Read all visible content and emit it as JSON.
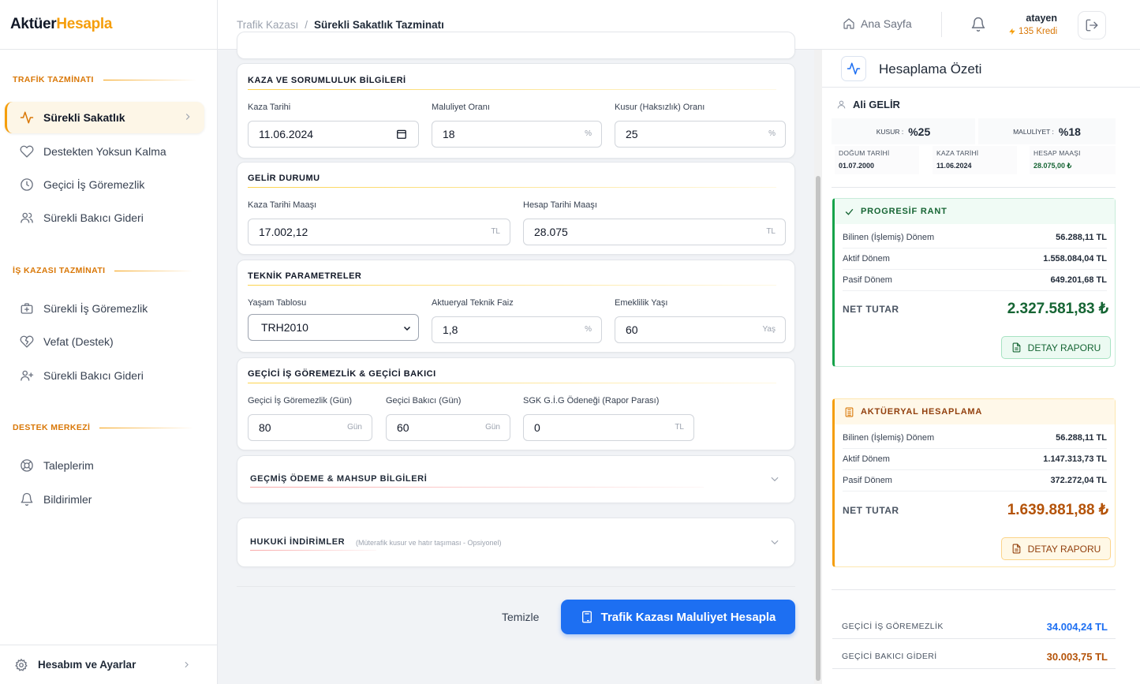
{
  "brand": {
    "part1": "Aktüer",
    "part2": "Hesapla",
    "accent": "#f59e0b"
  },
  "sidebar": {
    "sections": [
      {
        "title": "TRAFİK TAZMİNATI",
        "items": [
          {
            "label": "Sürekli Sakatlık",
            "icon": "activity-icon",
            "active": true
          },
          {
            "label": "Destekten Yoksun Kalma",
            "icon": "heart-icon"
          },
          {
            "label": "Geçici İş Göremezlik",
            "icon": "clock-icon"
          },
          {
            "label": "Sürekli Bakıcı Gideri",
            "icon": "users-icon"
          }
        ]
      },
      {
        "title": "İŞ KAZASI TAZMİNATI",
        "items": [
          {
            "label": "Sürekli İş Göremezlik",
            "icon": "briefcase-medical-icon"
          },
          {
            "label": "Vefat (Destek)",
            "icon": "heart-crack-icon"
          },
          {
            "label": "Sürekli Bakıcı Gideri",
            "icon": "user-plus-icon"
          }
        ]
      },
      {
        "title": "DESTEK MERKEZİ",
        "items": [
          {
            "label": "Taleplerim",
            "icon": "lifebuoy-icon"
          },
          {
            "label": "Bildirimler",
            "icon": "bell-icon"
          }
        ]
      }
    ],
    "account": "Hesabım ve Ayarlar"
  },
  "header": {
    "breadcrumb": [
      "Trafik Kazası",
      "Sürekli Sakatlık Tazminatı"
    ],
    "home": "Ana Sayfa",
    "username": "atayen",
    "credit": "135 Kredi"
  },
  "form": {
    "accident": {
      "title": "KAZA VE SORUMLULUK BİLGİLERİ",
      "date_label": "Kaza Tarihi",
      "date_value": "11.06.2024",
      "disability_label": "Maluliyet Oranı",
      "disability_value": "18",
      "disability_unit": "%",
      "fault_label": "Kusur (Haksızlık) Oranı",
      "fault_value": "25",
      "fault_unit": "%"
    },
    "income": {
      "title": "GELİR DURUMU",
      "acc_salary_label": "Kaza Tarihi Maaşı",
      "acc_salary_value": "17.002,12",
      "acc_salary_unit": "TL",
      "calc_salary_label": "Hesap Tarihi Maaşı",
      "calc_salary_value": "28.075",
      "calc_salary_unit": "TL"
    },
    "tech": {
      "title": "TEKNİK PARAMETRELER",
      "table_label": "Yaşam Tablosu",
      "table_value": "TRH2010",
      "rate_label": "Aktueryal Teknik Faiz",
      "rate_value": "1,8",
      "rate_unit": "%",
      "retire_label": "Emeklilik Yaşı",
      "retire_value": "60",
      "retire_unit": "Yaş"
    },
    "temp": {
      "title": "GEÇİCİ İŞ GÖREMEZLİK & GEÇİCİ BAKICI",
      "gig_label": "Geçici İş Göremezlik (Gün)",
      "gig_value": "80",
      "gig_unit": "Gün",
      "care_label": "Geçici Bakıcı (Gün)",
      "care_value": "60",
      "care_unit": "Gün",
      "sgk_label": "SGK G.İ.G Ödeneği (Rapor Parası)",
      "sgk_value": "0",
      "sgk_unit": "TL"
    },
    "past": {
      "title": "GEÇMİŞ ÖDEME & MAHSUP BİLGİLERİ"
    },
    "legal": {
      "title": "HUKUKİ İNDİRİMLER",
      "note": "(Müterafik kusur ve hatır taşıması - Opsiyonel)"
    },
    "clear": "Temizle",
    "submit": "Trafik Kazası Maluliyet Hesapla"
  },
  "summary": {
    "title": "Hesaplama Özeti",
    "person": "Ali GELİR",
    "fault_key": "KUSUR :",
    "fault_val": "%25",
    "dis_key": "MALULİYET :",
    "dis_val": "%18",
    "meta": [
      {
        "k": "DOĞUM TARİHİ",
        "v": "01.07.2000"
      },
      {
        "k": "KAZA TARİHİ",
        "v": "11.06.2024"
      },
      {
        "k": "HESAP MAAŞI",
        "v": "28.075,00 ₺"
      }
    ],
    "progressive": {
      "title": "PROGRESİF RANT",
      "rows": [
        {
          "k": "Bilinen (İşlemiş) Dönem",
          "v": "56.288,11 TL"
        },
        {
          "k": "Aktif Dönem",
          "v": "1.558.084,04 TL"
        },
        {
          "k": "Pasif Dönem",
          "v": "649.201,68 TL"
        }
      ],
      "net_key": "NET TUTAR",
      "net_val": "2.327.581,83 ₺",
      "button": "DETAY RAPORU"
    },
    "actuarial": {
      "title": "AKTÜERYAL HESAPLAMA",
      "rows": [
        {
          "k": "Bilinen (İşlemiş) Dönem",
          "v": "56.288,11 TL"
        },
        {
          "k": "Aktif Dönem",
          "v": "1.147.313,73 TL"
        },
        {
          "k": "Pasif Dönem",
          "v": "372.272,04 TL"
        }
      ],
      "net_key": "NET TUTAR",
      "net_val": "1.639.881,88 ₺",
      "button": "DETAY RAPORU"
    },
    "totals": [
      {
        "k": "GEÇİCİ İŞ GÖREMEZLİK",
        "v": "34.004,24 TL",
        "color": "#1d6ff2"
      },
      {
        "k": "GEÇİCİ BAKICI GİDERİ",
        "v": "30.003,75 TL",
        "color": "#b45309"
      }
    ]
  }
}
